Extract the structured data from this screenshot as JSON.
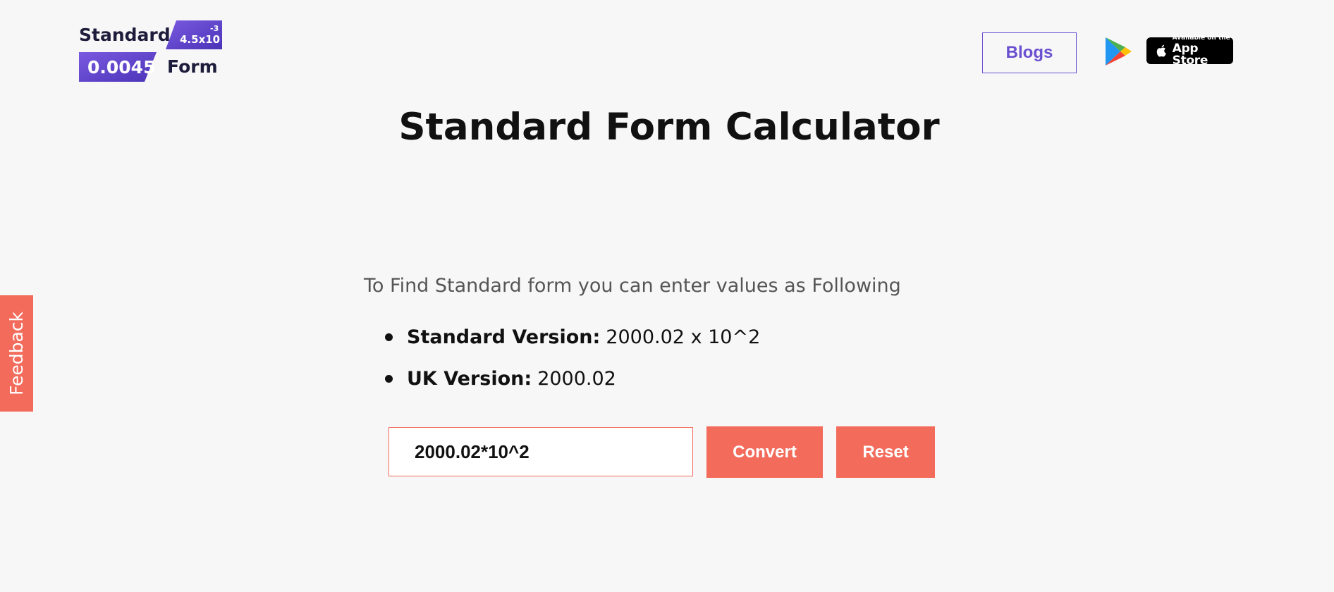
{
  "logo": {
    "word_top": "Standard",
    "word_bottom": "Form",
    "badge_top_base": "4.5x10",
    "badge_top_exponent": "-3",
    "badge_bottom": "0.0045"
  },
  "header": {
    "blogs_label": "Blogs",
    "google_play_icon": "google-play-icon",
    "app_store": {
      "small_text": "Available on the",
      "large_text": "App Store"
    }
  },
  "main": {
    "title": "Standard Form Calculator",
    "instructions": "To Find Standard form you can enter values as Following",
    "formats": [
      {
        "label": "Standard Version:",
        "value": "2000.02 x 10^2"
      },
      {
        "label": "UK Version:",
        "value": "2000.02"
      }
    ],
    "input_value": "2000.02*10^2",
    "convert_label": "Convert",
    "reset_label": "Reset"
  },
  "feedback": {
    "label": "Feedback"
  },
  "colors": {
    "accent": "#f26b5b",
    "brand_purple": "#6a4fd0",
    "background": "#f7f7f8"
  }
}
